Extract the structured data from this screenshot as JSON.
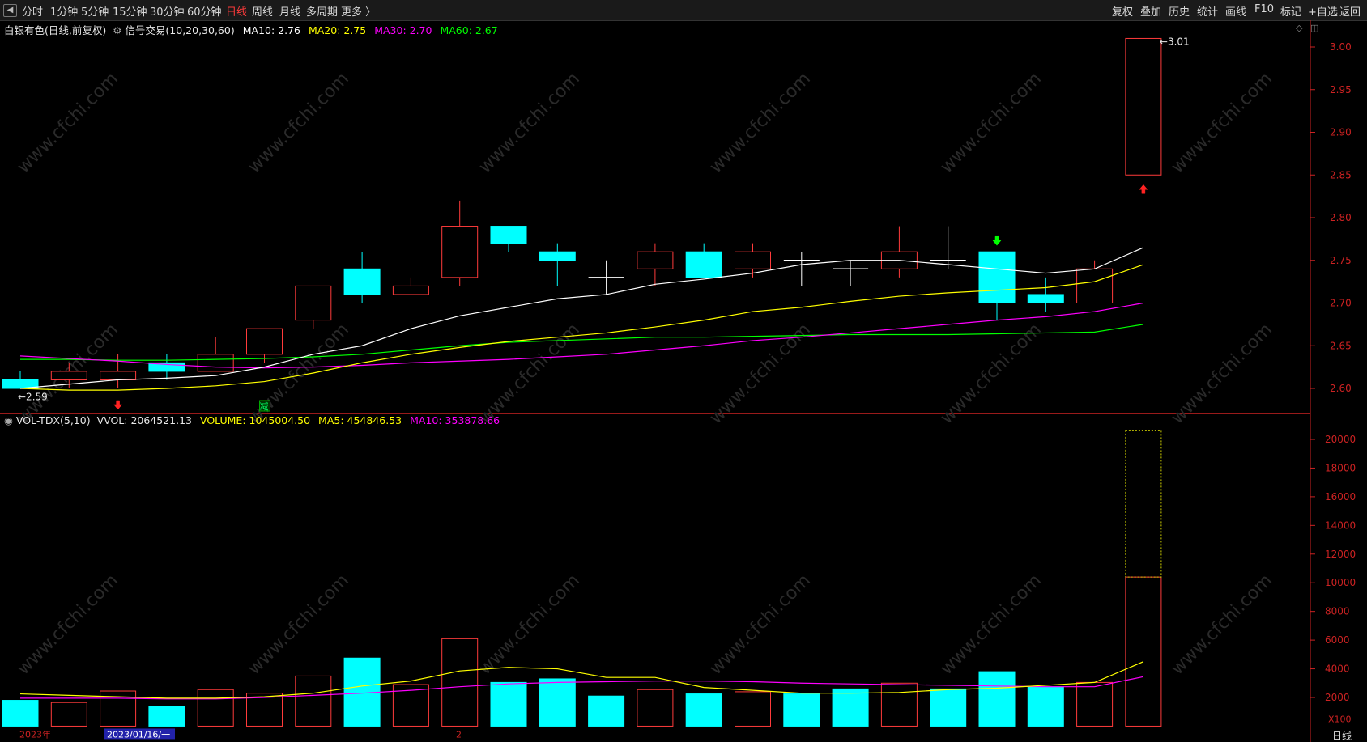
{
  "toolbar": {
    "left": [
      "分时",
      "1分钟",
      "5分钟",
      "15分钟",
      "30分钟",
      "60分钟",
      "日线",
      "周线",
      "月线",
      "多周期",
      "更多 〉"
    ],
    "active": "日线",
    "right": [
      "复权",
      "叠加",
      "历史",
      "统计",
      "画线",
      "F10",
      "标记",
      "+自选",
      "返回"
    ]
  },
  "price_header": {
    "name": "白银有色(日线,前复权)",
    "indicator": "信号交易(10,20,30,60)",
    "ma10": "MA10: 2.76",
    "ma20": "MA20: 2.75",
    "ma30": "MA30: 2.70",
    "ma60": "MA60: 2.67"
  },
  "volume_header": {
    "name": "VOL-TDX(5,10)",
    "vvol": "VVOL: 2064521.13",
    "volume": "VOLUME: 1045004.50",
    "ma5": "MA5: 454846.53",
    "ma10": "MA10: 353878.66"
  },
  "labels": {
    "high_mark": "3.01",
    "low_mark": "2.59",
    "reduce_tag": "减",
    "vol_unit": "X100",
    "period_tag": "日线",
    "date_left": "2023年",
    "date_cursor": "2023/01/16/一",
    "date_2": "2"
  },
  "colors": {
    "up": "#ff3b3b",
    "down": "#00ffff",
    "ma10": "#ffffff",
    "ma20": "#ffff00",
    "ma30": "#ff00ff",
    "ma60": "#00ff00",
    "axis": "#cc2222"
  },
  "chart_data": {
    "type": "candlestick",
    "price_axis": {
      "ticks": [
        3.0,
        2.95,
        2.9,
        2.85,
        2.8,
        2.75,
        2.7,
        2.65,
        2.6
      ],
      "range": [
        2.58,
        3.02
      ]
    },
    "volume_axis": {
      "ticks": [
        20000,
        18000,
        16000,
        14000,
        12000,
        10000,
        8000,
        6000,
        4000,
        2000
      ],
      "range": [
        0,
        21000
      ],
      "unit": "X100"
    },
    "candles": [
      {
        "open": 2.61,
        "close": 2.6,
        "high": 2.62,
        "low": 2.6,
        "vol": 1800
      },
      {
        "open": 2.61,
        "close": 2.62,
        "high": 2.63,
        "low": 2.6,
        "vol": 1650
      },
      {
        "open": 2.61,
        "close": 2.62,
        "high": 2.64,
        "low": 2.6,
        "vol": 2450
      },
      {
        "open": 2.63,
        "close": 2.62,
        "high": 2.64,
        "low": 2.61,
        "vol": 1400
      },
      {
        "open": 2.62,
        "close": 2.64,
        "high": 2.66,
        "low": 2.62,
        "vol": 2550
      },
      {
        "open": 2.64,
        "close": 2.67,
        "high": 2.67,
        "low": 2.63,
        "vol": 2300
      },
      {
        "open": 2.68,
        "close": 2.72,
        "high": 2.72,
        "low": 2.67,
        "vol": 3500
      },
      {
        "open": 2.74,
        "close": 2.71,
        "high": 2.76,
        "low": 2.7,
        "vol": 4750
      },
      {
        "open": 2.71,
        "close": 2.72,
        "high": 2.73,
        "low": 2.71,
        "vol": 2900
      },
      {
        "open": 2.73,
        "close": 2.79,
        "high": 2.82,
        "low": 2.72,
        "vol": 6100
      },
      {
        "open": 2.79,
        "close": 2.77,
        "high": 2.79,
        "low": 2.76,
        "vol": 3050
      },
      {
        "open": 2.76,
        "close": 2.75,
        "high": 2.77,
        "low": 2.72,
        "vol": 3300
      },
      {
        "open": 2.73,
        "close": 2.73,
        "high": 2.75,
        "low": 2.71,
        "vol": 2100
      },
      {
        "open": 2.74,
        "close": 2.76,
        "high": 2.77,
        "low": 2.72,
        "vol": 2550
      },
      {
        "open": 2.76,
        "close": 2.73,
        "high": 2.77,
        "low": 2.73,
        "vol": 2250
      },
      {
        "open": 2.74,
        "close": 2.76,
        "high": 2.77,
        "low": 2.73,
        "vol": 2400
      },
      {
        "open": 2.75,
        "close": 2.75,
        "high": 2.76,
        "low": 2.72,
        "vol": 2250
      },
      {
        "open": 2.74,
        "close": 2.74,
        "high": 2.75,
        "low": 2.72,
        "vol": 2600
      },
      {
        "open": 2.74,
        "close": 2.76,
        "high": 2.79,
        "low": 2.73,
        "vol": 3000
      },
      {
        "open": 2.75,
        "close": 2.75,
        "high": 2.79,
        "low": 2.74,
        "vol": 2600
      },
      {
        "open": 2.76,
        "close": 2.7,
        "high": 2.76,
        "low": 2.68,
        "vol": 3800
      },
      {
        "open": 2.71,
        "close": 2.7,
        "high": 2.73,
        "low": 2.69,
        "vol": 2750
      },
      {
        "open": 2.7,
        "close": 2.74,
        "high": 2.75,
        "low": 2.7,
        "vol": 3050
      },
      {
        "open": 2.85,
        "close": 3.01,
        "high": 3.01,
        "low": 2.85,
        "vol": 10400,
        "vol_total": 20600
      }
    ],
    "ma10": [
      2.6,
      2.605,
      2.61,
      2.612,
      2.615,
      2.625,
      2.64,
      2.65,
      2.67,
      2.685,
      2.695,
      2.705,
      2.71,
      2.722,
      2.728,
      2.735,
      2.745,
      2.75,
      2.75,
      2.745,
      2.74,
      2.735,
      2.74,
      2.765
    ],
    "ma20": [
      2.6,
      2.598,
      2.598,
      2.6,
      2.603,
      2.608,
      2.618,
      2.63,
      2.64,
      2.648,
      2.655,
      2.66,
      2.665,
      2.672,
      2.68,
      2.69,
      2.695,
      2.702,
      2.708,
      2.712,
      2.715,
      2.718,
      2.725,
      2.745
    ],
    "ma30": [
      2.638,
      2.635,
      2.632,
      2.628,
      2.625,
      2.624,
      2.625,
      2.627,
      2.63,
      2.632,
      2.634,
      2.637,
      2.64,
      2.645,
      2.65,
      2.656,
      2.66,
      2.665,
      2.67,
      2.675,
      2.68,
      2.684,
      2.69,
      2.7
    ],
    "ma60": [
      2.634,
      2.634,
      2.633,
      2.633,
      2.634,
      2.635,
      2.637,
      2.64,
      2.645,
      2.65,
      2.654,
      2.656,
      2.658,
      2.66,
      2.66,
      2.661,
      2.662,
      2.663,
      2.663,
      2.663,
      2.664,
      2.665,
      2.666,
      2.675
    ],
    "vol_ma5": [
      2250,
      2150,
      2050,
      1950,
      1950,
      2050,
      2300,
      2800,
      3150,
      3850,
      4100,
      4000,
      3400,
      3400,
      2700,
      2500,
      2300,
      2300,
      2350,
      2550,
      2650,
      2850,
      3050,
      4500
    ],
    "vol_ma10": [
      1950,
      1950,
      1950,
      1900,
      1900,
      2000,
      2150,
      2300,
      2500,
      2750,
      2950,
      3050,
      3100,
      3150,
      3150,
      3100,
      3000,
      2950,
      2900,
      2850,
      2800,
      2750,
      2750,
      3450
    ]
  }
}
